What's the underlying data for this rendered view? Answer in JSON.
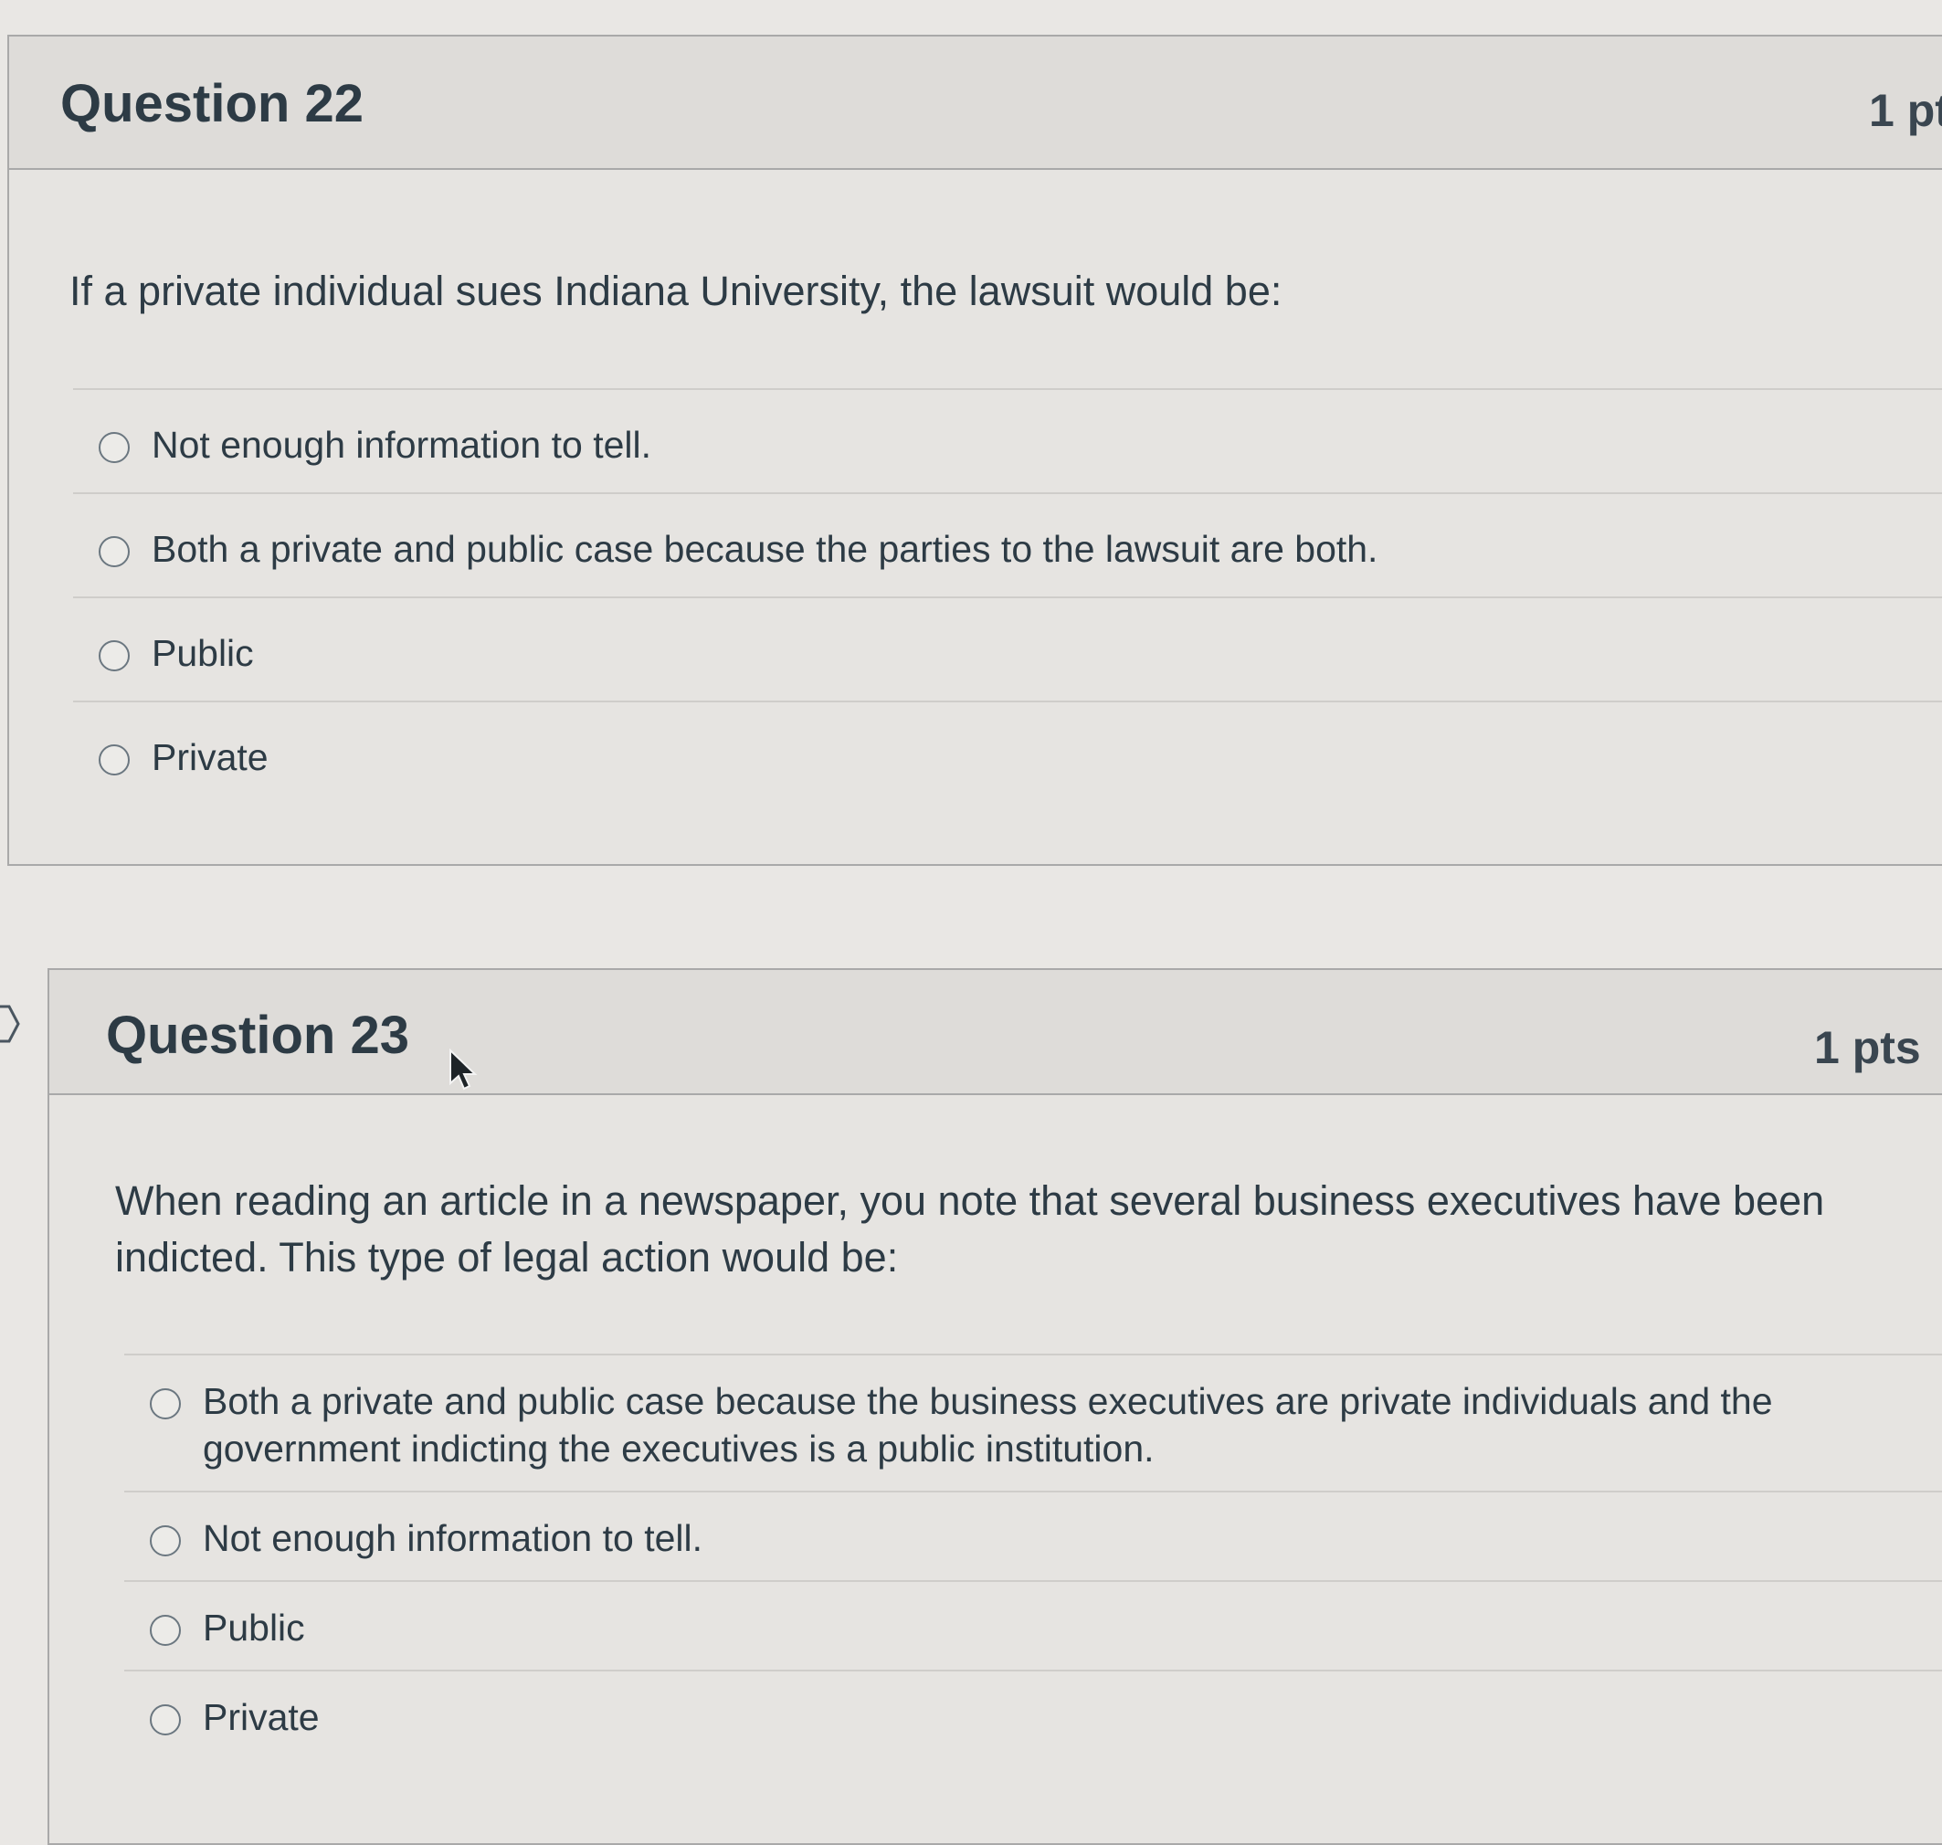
{
  "questions": [
    {
      "title": "Question 22",
      "points": "1 pt",
      "text": "If a private individual sues Indiana University, the lawsuit would be:",
      "answers": [
        "Not enough information to tell.",
        "Both a private and public case because the parties to the lawsuit are both.",
        "Public",
        "Private"
      ]
    },
    {
      "title": "Question 23",
      "points": "1 pts",
      "text": "When reading an article in a newspaper, you note that several business executives have been indicted. This type of legal action would be:",
      "answers": [
        "Both a private and public case because the business executives are private individuals and the government indicting the executives is a public institution.",
        "Not enough information to tell.",
        "Public",
        "Private"
      ]
    }
  ],
  "icons": {
    "side": "chevron-right-icon",
    "cursor": "mouse-pointer-icon"
  }
}
